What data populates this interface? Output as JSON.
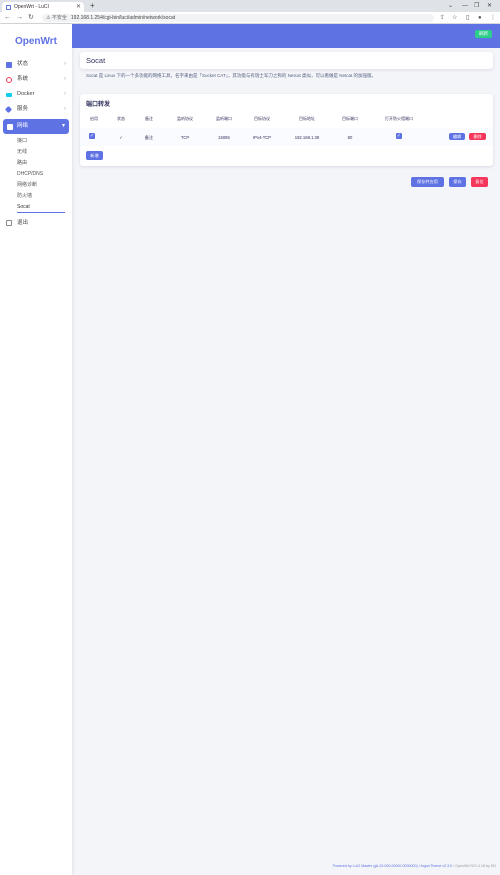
{
  "browser": {
    "tab_title": "OpenWrt - LuCI",
    "new_tab": "+",
    "window_controls": [
      "⌄",
      "—",
      "❐",
      "✕"
    ],
    "insecure_label": "不安全",
    "url": "192.168.1.254/cgi-bin/luci/admin/network/socat"
  },
  "sidebar": {
    "brand": "OpenWrt",
    "items": [
      {
        "label": "状态",
        "icon": "dashboard-icon",
        "color": "#5e72e4"
      },
      {
        "label": "系统",
        "icon": "gear-icon",
        "color": "#f5365c"
      },
      {
        "label": "Docker",
        "icon": "docker-icon",
        "color": "#11cdef"
      },
      {
        "label": "服务",
        "icon": "services-icon",
        "color": "#5e72e4"
      }
    ],
    "active": {
      "label": "网络",
      "icon": "network-icon"
    },
    "subitems": [
      "接口",
      "无线",
      "路由",
      "DHCP/DNS",
      "网络诊断",
      "防火墙",
      "Socat"
    ],
    "logout": "退出"
  },
  "header": {
    "button_label": "刷新",
    "accent": "#2dce89"
  },
  "page": {
    "title": "Socat",
    "description": "Socat 是 Linux 下的一个多功能的网络工具，名字来由是「Socket CAT」，其功能与有瑞士军刀之称的 Netcat 类似，可以看做是 Netcat 的加强版。"
  },
  "section": {
    "title": "端口转发",
    "headers": [
      "启用",
      "状态",
      "备注",
      "监听协议",
      "监听端口",
      "目标协议",
      "目标地址",
      "目标端口",
      "打开防火墙端口",
      ""
    ],
    "rows": [
      {
        "enabled": "✓",
        "status": "✓",
        "remark": "备注",
        "listen_proto": "TCP",
        "listen_port": "15085",
        "target_proto": "IPv4-TCP",
        "target_addr": "192.168.1.39",
        "target_port": "80",
        "firewall": "✓"
      }
    ],
    "edit_label": "编辑",
    "delete_label": "删除",
    "add_label": "新增"
  },
  "actions": {
    "save_apply": "保存并应用",
    "save": "保存",
    "reset": "复位"
  },
  "footer": {
    "left": "Powered by LuCI Master (git-20.000.00000-0000000) / ArgonTheme v2.3.0 ",
    "right": "/ OpenWrt R21.4.18 by DD"
  },
  "colors": {
    "primary": "#5e72e4",
    "danger": "#f5365c",
    "success": "#2dce89"
  }
}
